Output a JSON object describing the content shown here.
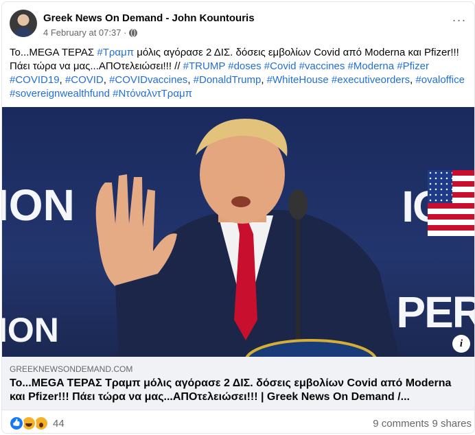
{
  "post": {
    "author": "Greek News On Demand - John Kountouris",
    "timestamp": "4 February at 07:37 ·",
    "more_label": "···",
    "body_segments": [
      {
        "t": "Το...MEGA ΤΕΡΑΣ ",
        "tag": false
      },
      {
        "t": "#Τραμπ",
        "tag": true
      },
      {
        "t": " μόλις αγόρασε 2 ΔΙΣ. δόσεις εμβολίων Covid από Moderna και Pfizer!!! Πάει τώρα να μας...ΑΠΟτελειώσει!!! // ",
        "tag": false
      },
      {
        "t": "#TRUMP",
        "tag": true
      },
      {
        "t": " ",
        "tag": false
      },
      {
        "t": "#doses",
        "tag": true
      },
      {
        "t": " ",
        "tag": false
      },
      {
        "t": "#Covid",
        "tag": true
      },
      {
        "t": " ",
        "tag": false
      },
      {
        "t": "#vaccines",
        "tag": true
      },
      {
        "t": " ",
        "tag": false
      },
      {
        "t": "#Moderna",
        "tag": true
      },
      {
        "t": " ",
        "tag": false
      },
      {
        "t": "#Pfizer",
        "tag": true
      },
      {
        "t": " ",
        "tag": false
      },
      {
        "t": "#COVID19",
        "tag": true
      },
      {
        "t": ", ",
        "tag": false
      },
      {
        "t": "#COVID",
        "tag": true
      },
      {
        "t": ", ",
        "tag": false
      },
      {
        "t": "#COVIDvaccines",
        "tag": true
      },
      {
        "t": ", ",
        "tag": false
      },
      {
        "t": "#DonaldTrump",
        "tag": true
      },
      {
        "t": ", ",
        "tag": false
      },
      {
        "t": "#WhiteHouse",
        "tag": true
      },
      {
        "t": " ",
        "tag": false
      },
      {
        "t": "#executiveorders",
        "tag": true
      },
      {
        "t": ", ",
        "tag": false
      },
      {
        "t": "#ovaloffice",
        "tag": true
      },
      {
        "t": " ",
        "tag": false
      },
      {
        "t": "#sovereignwealthfund",
        "tag": true
      },
      {
        "t": " ",
        "tag": false
      },
      {
        "t": "#ΝτόναλντΤραμπ",
        "tag": true
      }
    ],
    "image": {
      "bg_text_left": "ION",
      "bg_text_right": "ION",
      "bg_text_right_bottom": "PER",
      "bg_text_left_bottom": "ION",
      "info_icon": "i"
    },
    "link": {
      "domain": "GREEKNEWSONDEMAND.COM",
      "title": "Το...MEGA ΤΕΡΑΣ Τραμπ μόλις αγόρασε 2 ΔΙΣ. δόσεις εμβολίων Covid από Moderna και Pfizer!!! Πάει τώρα να μας...ΑΠΟτελειώσει!!! | Greek News On Demand /..."
    },
    "stats": {
      "reaction_count": "44",
      "reactions": [
        "like-icon",
        "haha-icon",
        "wow-icon"
      ],
      "comments": "9 comments",
      "shares": "9 shares"
    }
  },
  "colors": {
    "hashtag": "#216fdb",
    "secondary_text": "#65676b",
    "link_bg": "#f0f2f5"
  }
}
